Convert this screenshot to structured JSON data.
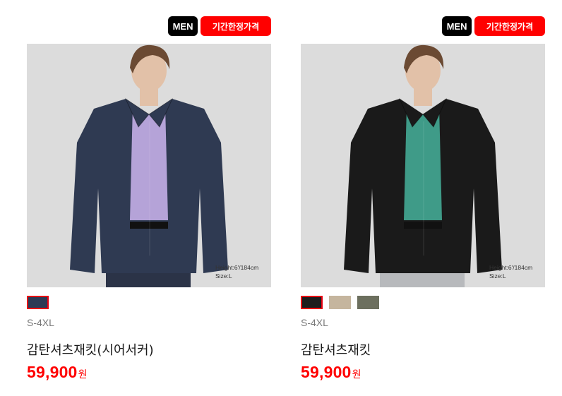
{
  "products": [
    {
      "flags": {
        "gender": "MEN",
        "promo": "기간한정가격"
      },
      "photo_caption": {
        "line1": "Height:6'/184cm",
        "line2": "Size:L"
      },
      "colors": {
        "background": "#dcdcdc",
        "jacket": "#2f3a52",
        "shirt": "#b5a3d8",
        "hair": "#6b4a33",
        "skin": "#e2c1a8",
        "pants": "#2b3347"
      },
      "swatches": [
        {
          "color": "#2c3a55",
          "selected": true
        }
      ],
      "size_range": "S-4XL",
      "name": "감탄셔츠재킷(시어서커)",
      "price": {
        "value": "59,900",
        "unit": "원"
      }
    },
    {
      "flags": {
        "gender": "MEN",
        "promo": "기간한정가격"
      },
      "photo_caption": {
        "line1": "Height:6'/184cm",
        "line2": "Size:L"
      },
      "colors": {
        "background": "#dcdcdc",
        "jacket": "#1a1a1a",
        "shirt": "#3f9b88",
        "hair": "#6b4a33",
        "skin": "#e2c1a8",
        "pants": "#b7b9bc"
      },
      "swatches": [
        {
          "color": "#1d1d1d",
          "selected": true
        },
        {
          "color": "#c5b59e",
          "selected": false
        },
        {
          "color": "#6c6f5e",
          "selected": false
        }
      ],
      "size_range": "S-4XL",
      "name": "감탄셔츠재킷",
      "price": {
        "value": "59,900",
        "unit": "원"
      }
    }
  ]
}
